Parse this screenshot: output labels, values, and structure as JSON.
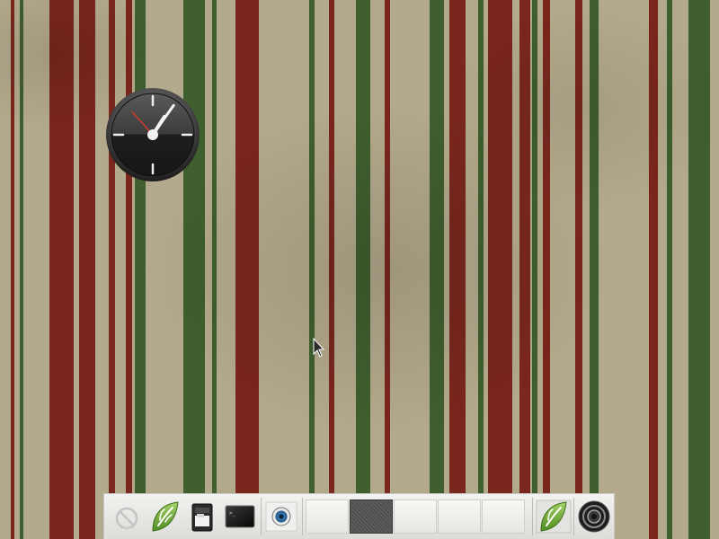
{
  "desktop": {
    "wallpaper": "red-green-vertical-stripes",
    "colors": {
      "base": "#b3a98c",
      "red_stripe": "#7a271d",
      "green_stripe": "#3f5f2e",
      "dock": "#ececea"
    }
  },
  "clock_widget": {
    "icon": "analog-clock",
    "hour": 1,
    "minute": 5,
    "second": 53
  },
  "cursor": {
    "icon": "arrow-pointer-icon"
  },
  "dock": {
    "launchers": [
      {
        "name": "shutdown-launcher",
        "icon": "power-icon"
      },
      {
        "name": "menu-launcher",
        "icon": "leaf-logo-icon"
      },
      {
        "name": "file-manager-launcher",
        "icon": "file-manager-icon"
      },
      {
        "name": "terminal-launcher",
        "icon": "terminal-icon"
      },
      {
        "name": "web-browser-launcher",
        "icon": "globe-icon"
      }
    ],
    "workspaces": {
      "count": 5,
      "active": 2
    },
    "trailing": [
      {
        "name": "menu-leaf-launcher",
        "icon": "leaf-logo-icon"
      },
      {
        "name": "audio-launcher",
        "icon": "speaker-icon"
      }
    ]
  }
}
